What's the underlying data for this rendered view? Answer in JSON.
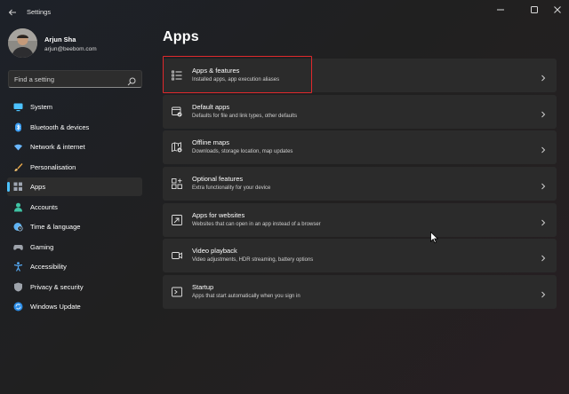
{
  "window": {
    "title": "Settings",
    "back_icon": "back-arrow-icon",
    "controls": [
      "minimize-icon",
      "maximize-icon",
      "close-icon"
    ]
  },
  "profile": {
    "name": "Arjun Sha",
    "email": "arjun@beebom.com"
  },
  "search": {
    "placeholder": "Find a setting",
    "icon": "search-icon"
  },
  "nav": {
    "items": [
      {
        "label": "System",
        "icon": "monitor-icon",
        "color": "#4cc2ff"
      },
      {
        "label": "Bluetooth & devices",
        "icon": "bluetooth-icon",
        "color": "#3b9ff5"
      },
      {
        "label": "Network & internet",
        "icon": "wifi-icon",
        "color": "#6ab7ff"
      },
      {
        "label": "Personalisation",
        "icon": "brush-icon",
        "color": "#e8a84a"
      },
      {
        "label": "Apps",
        "icon": "apps-icon",
        "color": "#9fa6b2",
        "selected": true
      },
      {
        "label": "Accounts",
        "icon": "person-icon",
        "color": "#3fc3a4"
      },
      {
        "label": "Time & language",
        "icon": "globe-clock-icon",
        "color": "#5fb2f2"
      },
      {
        "label": "Gaming",
        "icon": "controller-icon",
        "color": "#9ea3ab"
      },
      {
        "label": "Accessibility",
        "icon": "accessibility-icon",
        "color": "#55a9f5"
      },
      {
        "label": "Privacy & security",
        "icon": "shield-icon",
        "color": "#9ea3ab"
      },
      {
        "label": "Windows Update",
        "icon": "update-icon",
        "color": "#2b8de8"
      }
    ],
    "accent": "#4cc2ff"
  },
  "main": {
    "title": "Apps",
    "cards": [
      {
        "title": "Apps & features",
        "subtitle": "Installed apps, app execution aliases",
        "icon": "apps-list-icon"
      },
      {
        "title": "Default apps",
        "subtitle": "Defaults for file and link types, other defaults",
        "icon": "default-apps-icon"
      },
      {
        "title": "Offline maps",
        "subtitle": "Downloads, storage location, map updates",
        "icon": "map-download-icon"
      },
      {
        "title": "Optional features",
        "subtitle": "Extra functionality for your device",
        "icon": "add-features-icon"
      },
      {
        "title": "Apps for websites",
        "subtitle": "Websites that can open in an app instead of a browser",
        "icon": "link-window-icon"
      },
      {
        "title": "Video playback",
        "subtitle": "Video adjustments, HDR streaming, battery options",
        "icon": "video-icon"
      },
      {
        "title": "Startup",
        "subtitle": "Apps that start automatically when you sign in",
        "icon": "startup-icon"
      }
    ],
    "highlight_color": "#e0292c"
  }
}
